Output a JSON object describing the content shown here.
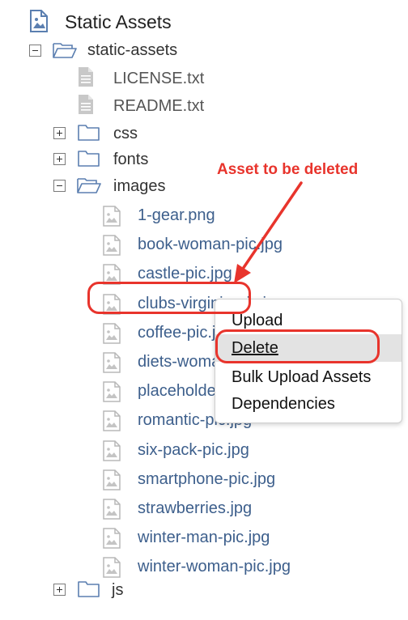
{
  "panel": {
    "title": "Static Assets"
  },
  "tree": {
    "root_folder": "static-assets",
    "files": [
      "LICENSE.txt",
      "README.txt"
    ],
    "folders": {
      "css": "css",
      "fonts": "fonts",
      "images": "images",
      "js": "js"
    },
    "images": [
      "1-gear.png",
      "book-woman-pic.jpg",
      "castle-pic.jpg",
      "clubs-virginia-pic.jpg",
      "coffee-pic.jpg",
      "diets-woman-pic.jpg",
      "placeholder.jpg",
      "romantic-pic.jpg",
      "six-pack-pic.jpg",
      "smartphone-pic.jpg",
      "strawberries.jpg",
      "winter-man-pic.jpg",
      "winter-woman-pic.jpg"
    ]
  },
  "context_menu": {
    "items": [
      "Upload",
      "Delete",
      "Bulk Upload Assets",
      "Dependencies"
    ],
    "highlighted": "Delete"
  },
  "annotation": {
    "text": "Asset to be deleted",
    "color": "#e8342c"
  },
  "colors": {
    "link": "#3d5f8c",
    "text": "#333333",
    "icon": "#5b7fb0"
  }
}
